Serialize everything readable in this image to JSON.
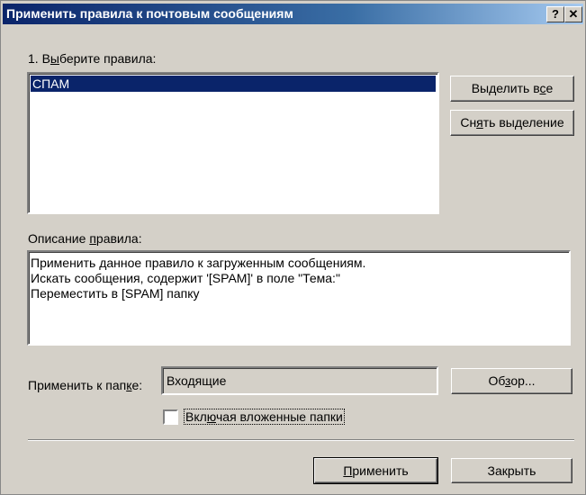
{
  "window": {
    "title": "Применить правила к почтовым сообщениям",
    "help_glyph": "?",
    "close_glyph": "✕"
  },
  "rules": {
    "label_prefix": "1. В",
    "label_hotkey": "ы",
    "label_suffix": "берите правила:",
    "items": [
      {
        "label": "СПАМ",
        "selected": true
      }
    ]
  },
  "buttons": {
    "select_all": {
      "prefix": "Выделить в",
      "hotkey": "с",
      "suffix": "е"
    },
    "deselect": {
      "prefix": "Сн",
      "hotkey": "я",
      "suffix": "ть выделение"
    },
    "browse": {
      "prefix": "Об",
      "hotkey": "з",
      "suffix": "ор..."
    },
    "apply": {
      "hotkey": "П",
      "suffix": "рименить"
    },
    "close": {
      "label": "Закрыть"
    }
  },
  "description": {
    "label_prefix": "Описание ",
    "label_hotkey": "п",
    "label_suffix": "равила:",
    "lines": [
      "Применить данное правило к загруженным сообщениям.",
      "Искать сообщения, содержит '[SPAM]' в поле \"Тема:\"",
      "Переместить в [SPAM] папку"
    ]
  },
  "folder": {
    "label_prefix": "Применить к пап",
    "label_hotkey": "к",
    "label_suffix": "е:",
    "value": "Входящие"
  },
  "include_subfolders": {
    "prefix": "Вкл",
    "hotkey": "ю",
    "suffix": "чая вложенные папки",
    "checked": false
  },
  "colors": {
    "dialog_bg": "#d4d0c8",
    "title_start": "#0a246a",
    "title_end": "#a6caf0",
    "selection": "#0a246a"
  }
}
